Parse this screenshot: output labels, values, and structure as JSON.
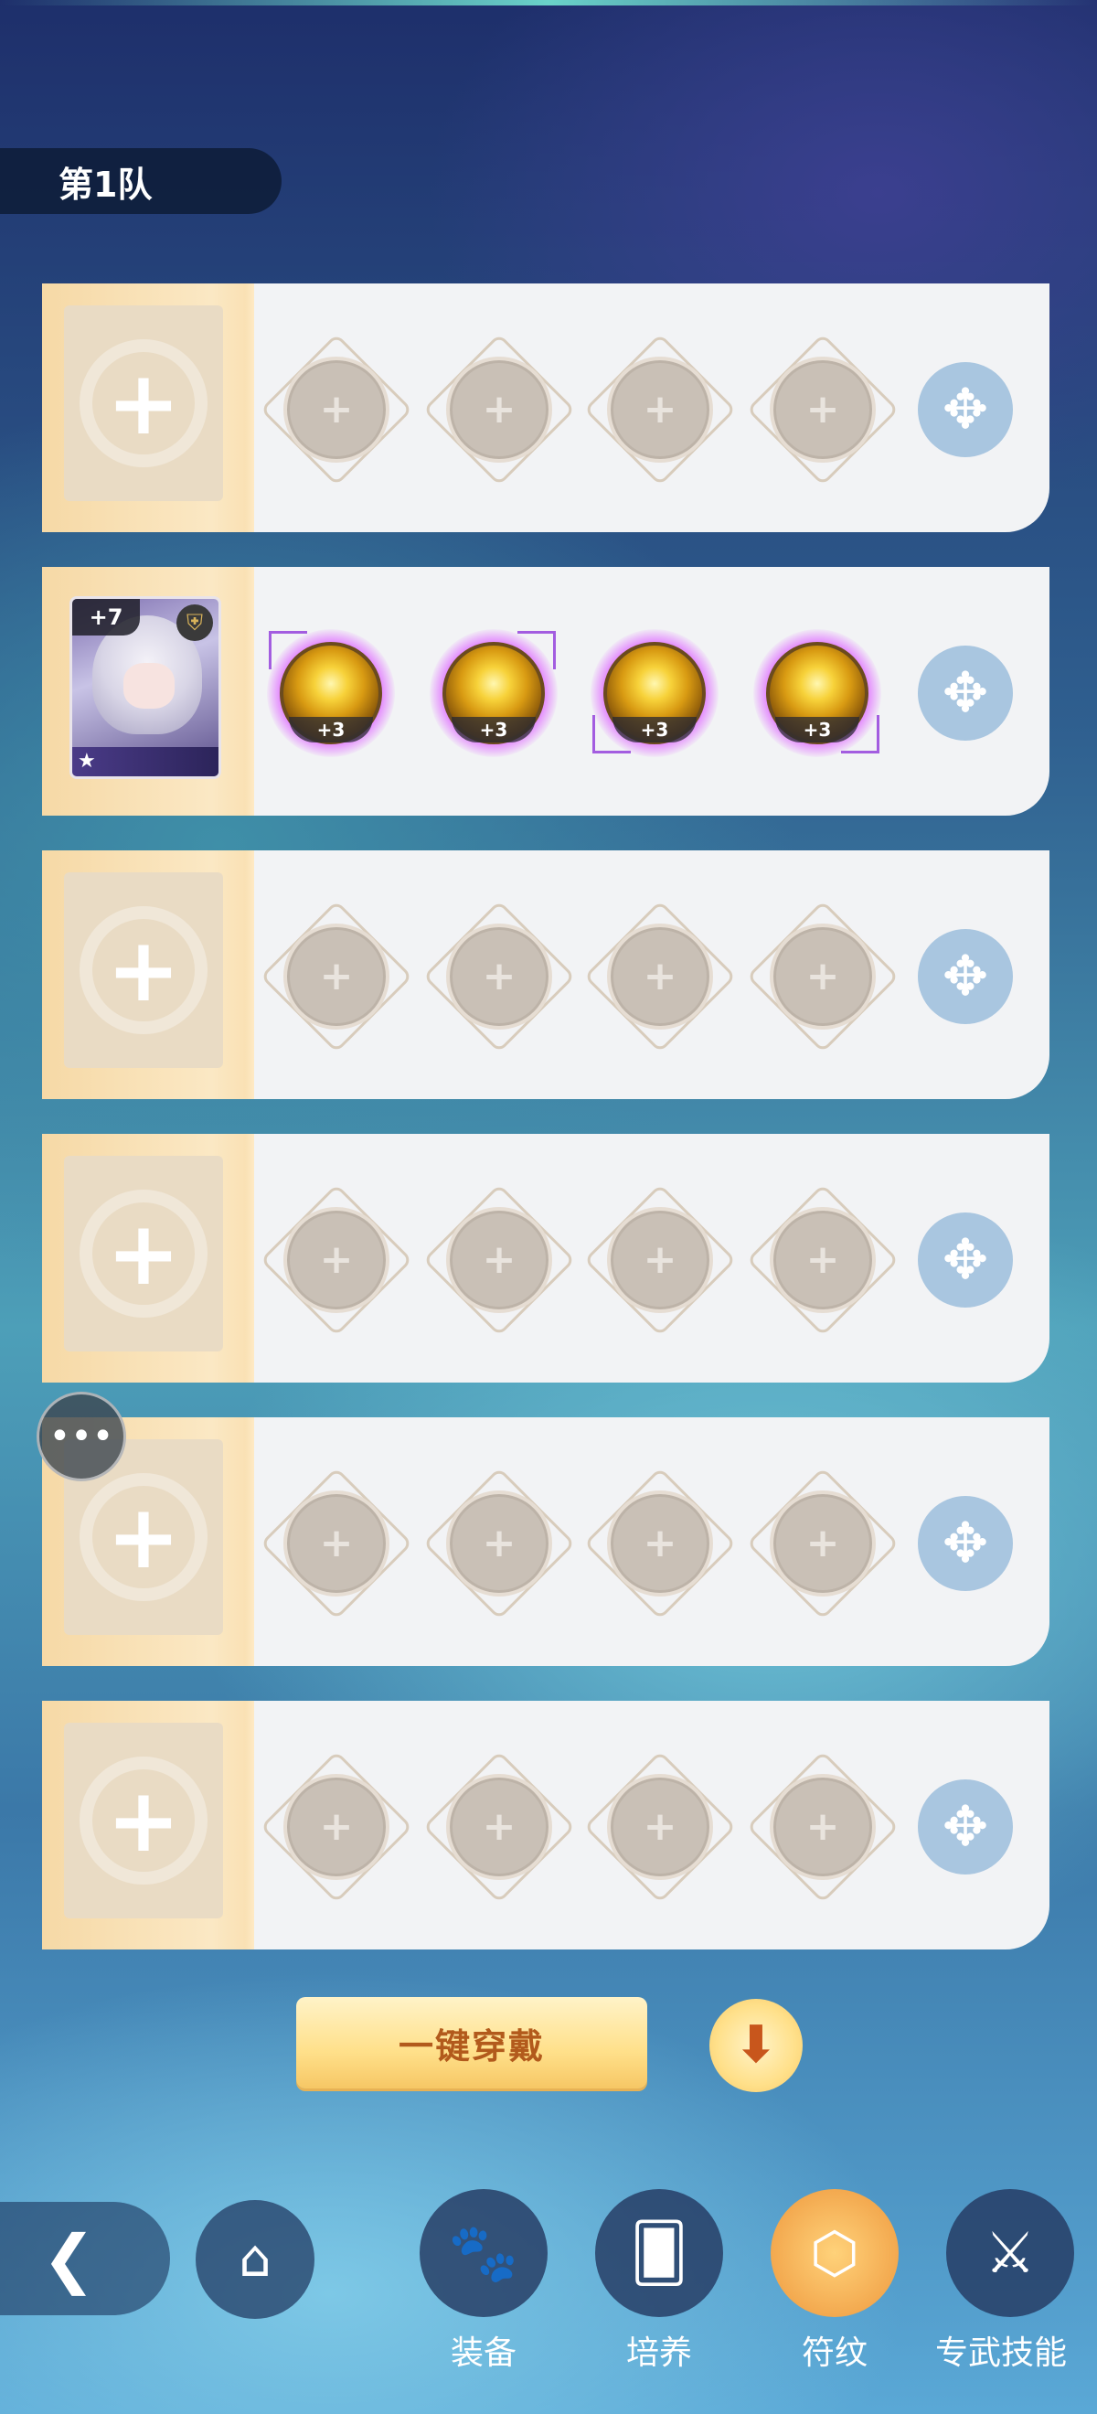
{
  "header": {
    "team_label": "第1队"
  },
  "rows": [
    {
      "hero": null,
      "runes": [
        "+",
        "+",
        "+",
        "+"
      ]
    },
    {
      "hero": {
        "level": "+7",
        "star": "★"
      },
      "runes": [
        "+3",
        "+3",
        "+3",
        "+3"
      ]
    },
    {
      "hero": null,
      "runes": [
        "+",
        "+",
        "+",
        "+"
      ]
    },
    {
      "hero": null,
      "runes": [
        "+",
        "+",
        "+",
        "+"
      ]
    },
    {
      "hero": null,
      "runes": [
        "+",
        "+",
        "+",
        "+"
      ]
    },
    {
      "hero": null,
      "runes": [
        "+",
        "+",
        "+",
        "+"
      ]
    }
  ],
  "empty_slot_plus": "+",
  "actions": {
    "wear_all_label": "一键穿戴"
  },
  "icons": {
    "swap": "swap-icon",
    "down": "arrow-down-icon",
    "back": "back-icon",
    "home": "home-icon",
    "chat": "chat-icon",
    "shield": "shield-icon"
  },
  "nav": {
    "items": [
      {
        "label": "装备",
        "icon": "paw-icon",
        "active": false
      },
      {
        "label": "培养",
        "icon": "cards-icon",
        "active": false
      },
      {
        "label": "符纹",
        "icon": "rune-icon",
        "active": true
      },
      {
        "label": "专武技能",
        "icon": "weapon-icon",
        "active": false
      }
    ]
  },
  "colors": {
    "accent_gold": "#f6c765",
    "rune_glow": "#e178ff",
    "panel": "#f2f3f5"
  }
}
